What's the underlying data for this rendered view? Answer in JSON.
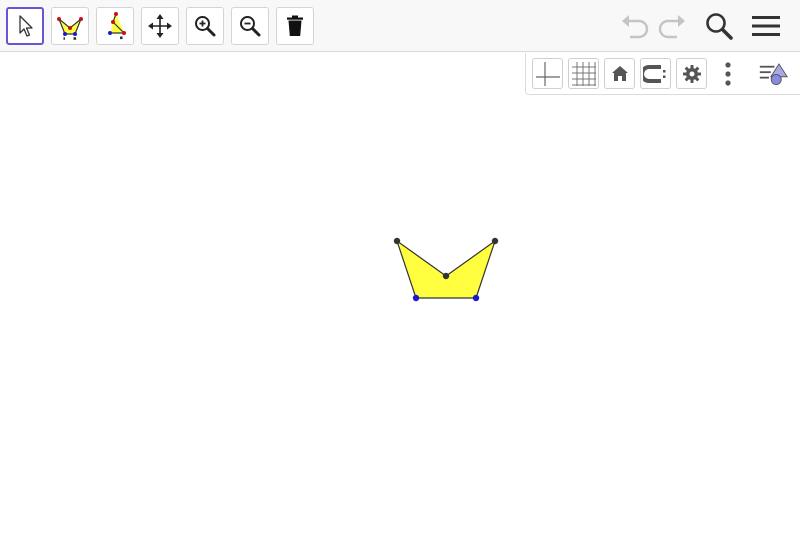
{
  "toolbar": {
    "tools": [
      {
        "id": "move",
        "icon": "cursor-arrow-icon",
        "active": true
      },
      {
        "id": "polygon",
        "icon": "polygon-tool-icon",
        "active": false
      },
      {
        "id": "polyline",
        "icon": "polyline-tool-icon",
        "active": false
      },
      {
        "id": "move-graphics-view",
        "icon": "move-arrows-icon",
        "active": false
      },
      {
        "id": "zoom-in",
        "icon": "zoom-in-icon",
        "active": false
      },
      {
        "id": "zoom-out",
        "icon": "zoom-out-icon",
        "active": false
      },
      {
        "id": "delete",
        "icon": "trash-icon",
        "active": false
      }
    ],
    "right": [
      "undo-icon",
      "redo-icon",
      "search-icon",
      "menu-icon"
    ],
    "undo_enabled": false,
    "redo_enabled": false
  },
  "style_bar": {
    "buttons": [
      "axes-icon",
      "grid-icon",
      "home-icon",
      "point-capturing-icon",
      "gear-icon",
      "more-options-icon",
      "toggle-style-bar-icon"
    ]
  },
  "colors": {
    "polygon_fill": "#ffff40",
    "polygon_stroke": "#333333",
    "free_point": "#333333",
    "base_point": "#1a1acc",
    "active_tool_border": "#6557d2"
  }
}
